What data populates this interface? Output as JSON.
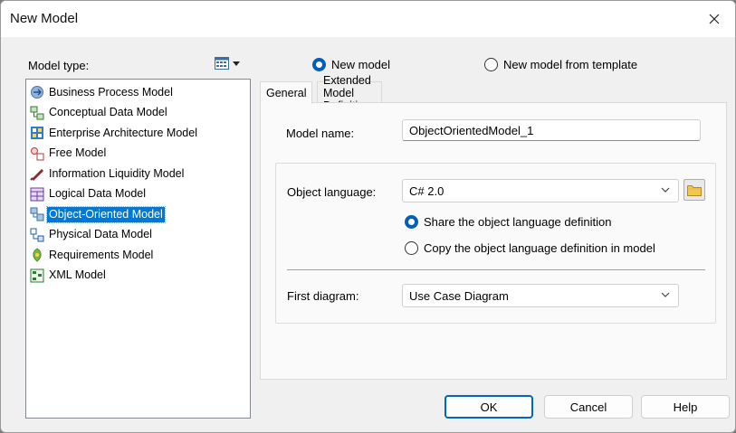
{
  "window": {
    "title": "New Model"
  },
  "model_type": {
    "label": "Model type:",
    "items": [
      {
        "label": "Business Process Model",
        "icon": "business-process-icon",
        "selected": false
      },
      {
        "label": "Conceptual Data Model",
        "icon": "conceptual-data-icon",
        "selected": false
      },
      {
        "label": "Enterprise Architecture Model",
        "icon": "enterprise-architecture-icon",
        "selected": false
      },
      {
        "label": "Free Model",
        "icon": "free-model-icon",
        "selected": false
      },
      {
        "label": "Information Liquidity Model",
        "icon": "information-liquidity-icon",
        "selected": false
      },
      {
        "label": "Logical Data Model",
        "icon": "logical-data-icon",
        "selected": false
      },
      {
        "label": "Object-Oriented Model",
        "icon": "object-oriented-icon",
        "selected": true
      },
      {
        "label": "Physical Data Model",
        "icon": "physical-data-icon",
        "selected": false
      },
      {
        "label": "Requirements Model",
        "icon": "requirements-icon",
        "selected": false
      },
      {
        "label": "XML Model",
        "icon": "xml-model-icon",
        "selected": false
      }
    ]
  },
  "mode": {
    "new_model": "New model",
    "from_template": "New model from template",
    "selected": "new_model"
  },
  "tabs": [
    {
      "label": "General",
      "active": true
    },
    {
      "label": "Extended Model Definitions",
      "active": false
    }
  ],
  "general": {
    "model_name_label": "Model name:",
    "model_name_value": "ObjectOrientedModel_1",
    "object_language_label": "Object language:",
    "object_language_value": "C# 2.0",
    "share_label": "Share the object language definition",
    "copy_label": "Copy the object language definition in model",
    "language_option_selected": "share",
    "first_diagram_label": "First diagram:",
    "first_diagram_value": "Use Case Diagram"
  },
  "buttons": {
    "ok": "OK",
    "cancel": "Cancel",
    "help": "Help"
  },
  "colors": {
    "accent": "#005fb8",
    "selection": "#0078d7",
    "dialog_bg": "#f0f0f0"
  }
}
